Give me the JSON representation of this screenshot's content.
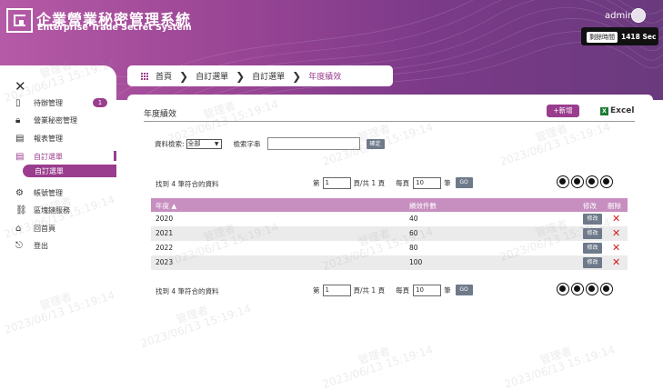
{
  "header": {
    "title_zh": "企業營業秘密管理系統",
    "title_en": "Enterprise Trade Secret System",
    "user": "admin",
    "timer_label": "剩餘時間",
    "timer_value": "1418 Sec"
  },
  "sidebar": {
    "items": [
      {
        "label": "待辦管理",
        "icon": "document-icon",
        "badge": "1"
      },
      {
        "label": "營業秘密管理",
        "icon": "lock-icon"
      },
      {
        "label": "報表管理",
        "icon": "report-icon"
      },
      {
        "label": "自訂選單",
        "icon": "list-icon",
        "active": true
      },
      {
        "label": "帳號管理",
        "icon": "gear-icon"
      },
      {
        "label": "區塊鏈服務",
        "icon": "blockchain-icon"
      },
      {
        "label": "回首頁",
        "icon": "home-icon"
      },
      {
        "label": "登出",
        "icon": "logout-icon"
      }
    ],
    "sub_item": "自訂選單"
  },
  "breadcrumb": [
    "首頁",
    "自訂選單",
    "自訂選單",
    "年度績效"
  ],
  "panel": {
    "title": "年度績效",
    "new_button": "+新增",
    "excel_button": "Excel",
    "filter": {
      "label": "資料檢索:",
      "select_value": "全部",
      "keyword_label": "檢索字串",
      "keyword_value": "",
      "confirm": "確定"
    },
    "pager": {
      "found": "找到 4 筆符合的資料",
      "page_prefix": "第",
      "page_value": "1",
      "page_suffix": "頁/共 1 頁",
      "per_page_prefix": "每頁",
      "per_page_value": "10",
      "per_page_suffix": "筆",
      "go": "GO"
    },
    "table": {
      "headers": {
        "year": "年度 ▲",
        "value": "績效件數",
        "edit": "修改",
        "delete": "刪除"
      },
      "edit_label": "修改",
      "delete_symbol": "✕",
      "rows": [
        {
          "year": "2020",
          "value": "40"
        },
        {
          "year": "2021",
          "value": "60"
        },
        {
          "year": "2022",
          "value": "80"
        },
        {
          "year": "2023",
          "value": "100"
        }
      ]
    }
  },
  "watermark": {
    "name": "管理者",
    "datetime": "2023/06/13 15:19:14"
  }
}
